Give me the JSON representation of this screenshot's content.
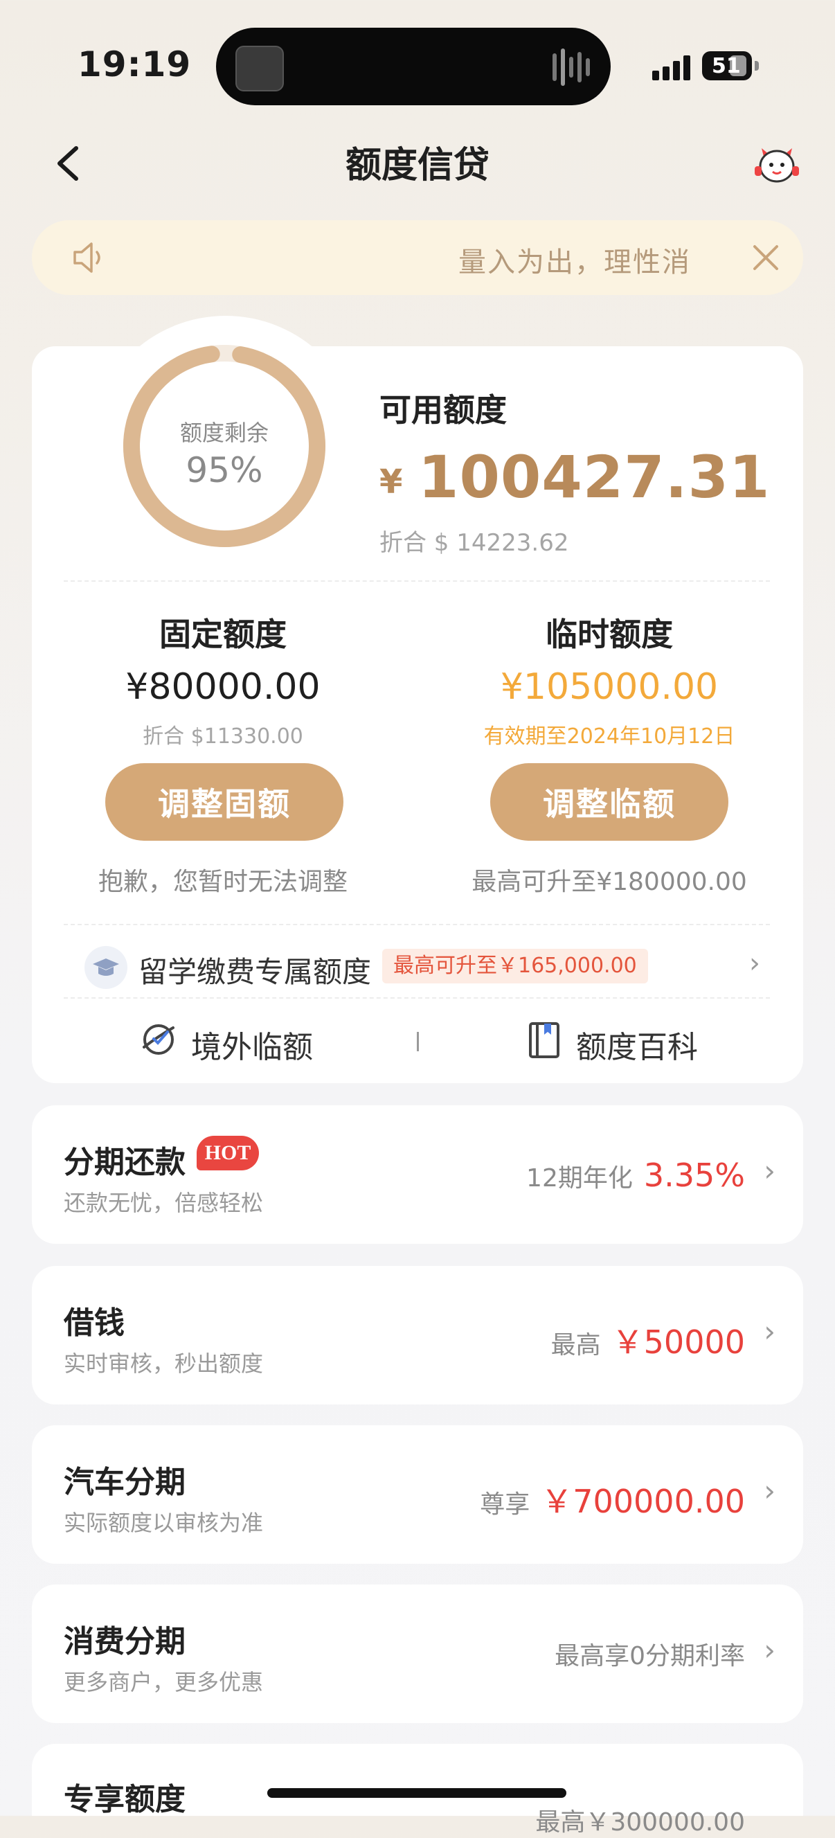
{
  "status_bar": {
    "time": "19:19",
    "battery": "51"
  },
  "nav": {
    "title": "额度信贷"
  },
  "notice": {
    "text": "量入为出，理性消"
  },
  "credit": {
    "ring_label": "额度剩余",
    "ring_percent": "95%",
    "ring_fraction": 0.95,
    "available_label": "可用额度",
    "currency_symbol": "¥",
    "available_amount": "100427.31",
    "available_usd": "折合 $ 14223.62",
    "fixed": {
      "title": "固定额度",
      "amount": "¥80000.00",
      "sub": "折合 $11330.00",
      "button": "调整固额",
      "note": "抱歉，您暂时无法调整"
    },
    "temporary": {
      "title": "临时额度",
      "amount": "¥105000.00",
      "sub": "有效期至2024年10月12日",
      "button": "调整临额",
      "note": "最高可升至¥180000.00"
    },
    "study": {
      "label": "留学缴费专属额度",
      "badge": "最高可升至￥165,000.00"
    },
    "quick_links": [
      "境外临额",
      "额度百科"
    ]
  },
  "services": [
    {
      "title": "分期还款",
      "badge": "HOT",
      "subtitle": "还款无忧，倍感轻松",
      "prefix": "12期年化",
      "value": "3.35%"
    },
    {
      "title": "借钱",
      "subtitle": "实时审核，秒出额度",
      "prefix": "最高",
      "value": "￥50000"
    },
    {
      "title": "汽车分期",
      "subtitle": "实际额度以审核为准",
      "prefix": "尊享",
      "value": "￥700000.00"
    },
    {
      "title": "消费分期",
      "subtitle": "更多商户，更多优惠",
      "prefix": "最高享0分期利率",
      "value": ""
    },
    {
      "title": "专享额度",
      "subtitle": "",
      "prefix": "最高￥300000.00",
      "value": ""
    }
  ],
  "colors": {
    "accent": "#d5a877",
    "gold_text": "#b88a5a",
    "temp_amount": "#f3a93a",
    "red": "#e8413c"
  }
}
